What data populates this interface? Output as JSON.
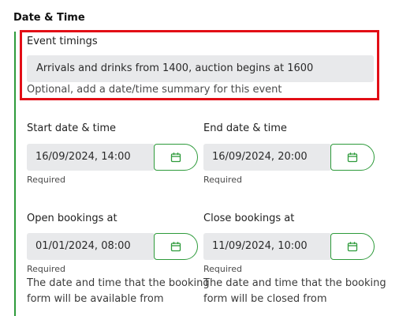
{
  "section": {
    "title": "Date & Time"
  },
  "event_timings": {
    "label": "Event timings",
    "value": "Arrivals and drinks from 1400, auction begins at 1600",
    "hint": "Optional, add a date/time summary for this event"
  },
  "start": {
    "label": "Start date & time",
    "value": "16/09/2024, 14:00",
    "required": "Required",
    "icon": "calendar-icon"
  },
  "end": {
    "label": "End date & time",
    "value": "16/09/2024, 20:00",
    "required": "Required",
    "icon": "calendar-icon"
  },
  "open_bookings": {
    "label": "Open bookings at",
    "value": "01/01/2024, 08:00",
    "required": "Required",
    "help_line1": "The date and time that the booking",
    "help_line2": "form will be available from",
    "icon": "calendar-icon"
  },
  "close_bookings": {
    "label": "Close bookings at",
    "value": "11/09/2024, 10:00",
    "required": "Required",
    "help_line1": "The date and time that the booking",
    "help_line2": "form will be closed from",
    "icon": "calendar-icon"
  },
  "colors": {
    "accent": "#2e9b3b",
    "highlight": "#e20e16",
    "field_bg": "#e8e9eb"
  }
}
